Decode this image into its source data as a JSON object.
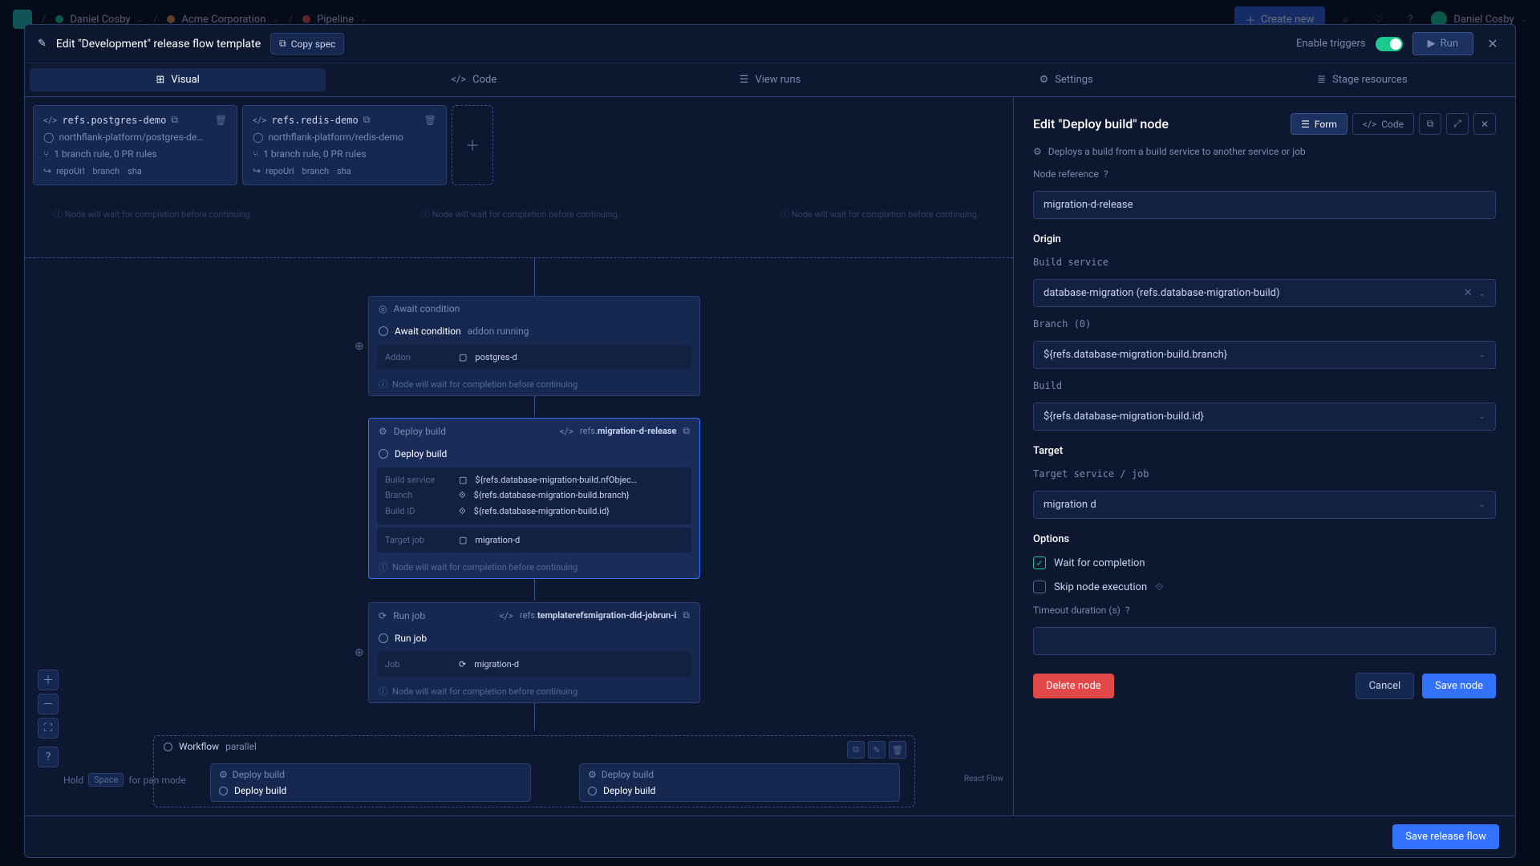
{
  "topbar": {
    "user": "Daniel Cosby",
    "org": "Acme Corporation",
    "project": "Pipeline",
    "create_new": "Create new"
  },
  "sheet": {
    "title": "Edit \"Development\" release flow template",
    "copy_spec": "Copy spec",
    "enable_triggers": "Enable triggers",
    "run": "Run"
  },
  "tabs": {
    "visual": "Visual",
    "code": "Code",
    "view_runs": "View runs",
    "settings": "Settings",
    "stage_resources": "Stage resources"
  },
  "repos": [
    {
      "ref": "refs.postgres-demo",
      "path": "northflank-platform/postgres-de…",
      "rule": "1 branch rule, 0 PR rules",
      "tags": [
        "repoUrl",
        "branch",
        "sha"
      ]
    },
    {
      "ref": "refs.redis-demo",
      "path": "northflank-platform/redis-demo",
      "rule": "1 branch rule, 0 PR rules",
      "tags": [
        "repoUrl",
        "branch",
        "sha"
      ]
    }
  ],
  "ghost_text": "Node will wait for completion before continuing",
  "nodes": {
    "await": {
      "type": "Await condition",
      "title": "Await condition",
      "suffix": "addon running",
      "addon_label": "Addon",
      "addon_value": "postgres-d",
      "foot": "Node will wait for completion before continuing"
    },
    "deploy": {
      "type": "Deploy build",
      "ref_prefix": "refs.",
      "ref": "migration-d-release",
      "title": "Deploy build",
      "rows": [
        {
          "k": "Build service",
          "v": "${refs.database-migration-build.nfObjec…"
        },
        {
          "k": "Branch",
          "v": "${refs.database-migration-build.branch}"
        },
        {
          "k": "Build ID",
          "v": "${refs.database-migration-build.id}"
        }
      ],
      "target_label": "Target job",
      "target_value": "migration-d",
      "foot": "Node will wait for completion before continuing"
    },
    "runjob": {
      "type": "Run job",
      "ref_prefix": "refs.",
      "ref": "templaterefsmigration-did-jobrun-i",
      "title": "Run job",
      "job_label": "Job",
      "job_value": "migration-d",
      "foot": "Node will wait for completion before continuing"
    }
  },
  "parallel": {
    "title": "Workflow",
    "suffix": "parallel",
    "mini1_head": "Deploy build",
    "mini1_title": "Deploy build",
    "mini2_head": "Deploy build",
    "mini2_title": "Deploy build"
  },
  "canvas": {
    "hold": "Hold",
    "space": "Space",
    "pan": "for pan mode",
    "rf": "React Flow"
  },
  "side": {
    "title": "Edit \"Deploy build\" node",
    "form": "Form",
    "code": "Code",
    "desc": "Deploys a build from a build service to another service or job",
    "node_ref_label": "Node reference",
    "node_ref": "migration-d-release",
    "origin": "Origin",
    "build_service_label": "Build service",
    "build_service": "database-migration (refs.database-migration-build)",
    "branch_label": "Branch (0)",
    "branch": "${refs.database-migration-build.branch}",
    "build_label": "Build",
    "build": "${refs.database-migration-build.id}",
    "target": "Target",
    "target_service_label": "Target service / job",
    "target_service": "migration d",
    "options": "Options",
    "wait": "Wait for completion",
    "skip": "Skip node execution",
    "timeout_label": "Timeout duration (s)",
    "delete": "Delete node",
    "cancel": "Cancel",
    "save": "Save node"
  },
  "footer": {
    "save": "Save release flow"
  }
}
